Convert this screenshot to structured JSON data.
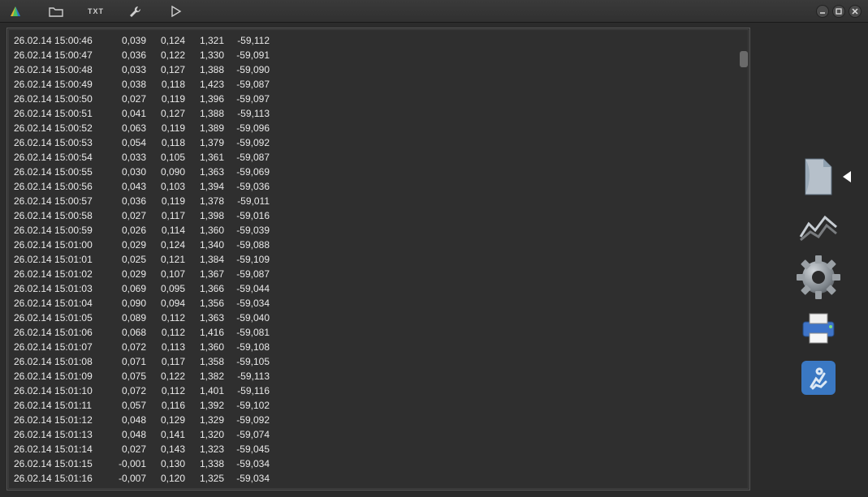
{
  "toolbar": {
    "txt_label": "TXT"
  },
  "icons": {
    "logo": "app-logo",
    "folder": "folder-icon",
    "txt": "txt-icon",
    "wrench": "wrench-icon",
    "play": "play-icon",
    "min": "window-minimize",
    "max": "window-maximize",
    "close": "window-close"
  },
  "palette": {
    "document": "document-tool",
    "chart": "chart-tool",
    "settings": "settings-tool",
    "print": "print-tool",
    "exit": "exit-tool"
  },
  "rows": [
    {
      "ts": "26.02.14 15:00:46",
      "a": "0,039",
      "b": "0,124",
      "c": "1,321",
      "d": "-59,112"
    },
    {
      "ts": "26.02.14 15:00:47",
      "a": "0,036",
      "b": "0,122",
      "c": "1,330",
      "d": "-59,091"
    },
    {
      "ts": "26.02.14 15:00:48",
      "a": "0,033",
      "b": "0,127",
      "c": "1,388",
      "d": "-59,090"
    },
    {
      "ts": "26.02.14 15:00:49",
      "a": "0,038",
      "b": "0,118",
      "c": "1,423",
      "d": "-59,087"
    },
    {
      "ts": "26.02.14 15:00:50",
      "a": "0,027",
      "b": "0,119",
      "c": "1,396",
      "d": "-59,097"
    },
    {
      "ts": "26.02.14 15:00:51",
      "a": "0,041",
      "b": "0,127",
      "c": "1,388",
      "d": "-59,113"
    },
    {
      "ts": "26.02.14 15:00:52",
      "a": "0,063",
      "b": "0,119",
      "c": "1,389",
      "d": "-59,096"
    },
    {
      "ts": "26.02.14 15:00:53",
      "a": "0,054",
      "b": "0,118",
      "c": "1,379",
      "d": "-59,092"
    },
    {
      "ts": "26.02.14 15:00:54",
      "a": "0,033",
      "b": "0,105",
      "c": "1,361",
      "d": "-59,087"
    },
    {
      "ts": "26.02.14 15:00:55",
      "a": "0,030",
      "b": "0,090",
      "c": "1,363",
      "d": "-59,069"
    },
    {
      "ts": "26.02.14 15:00:56",
      "a": "0,043",
      "b": "0,103",
      "c": "1,394",
      "d": "-59,036"
    },
    {
      "ts": "26.02.14 15:00:57",
      "a": "0,036",
      "b": "0,119",
      "c": "1,378",
      "d": "-59,011"
    },
    {
      "ts": "26.02.14 15:00:58",
      "a": "0,027",
      "b": "0,117",
      "c": "1,398",
      "d": "-59,016"
    },
    {
      "ts": "26.02.14 15:00:59",
      "a": "0,026",
      "b": "0,114",
      "c": "1,360",
      "d": "-59,039"
    },
    {
      "ts": "26.02.14 15:01:00",
      "a": "0,029",
      "b": "0,124",
      "c": "1,340",
      "d": "-59,088"
    },
    {
      "ts": "26.02.14 15:01:01",
      "a": "0,025",
      "b": "0,121",
      "c": "1,384",
      "d": "-59,109"
    },
    {
      "ts": "26.02.14 15:01:02",
      "a": "0,029",
      "b": "0,107",
      "c": "1,367",
      "d": "-59,087"
    },
    {
      "ts": "26.02.14 15:01:03",
      "a": "0,069",
      "b": "0,095",
      "c": "1,366",
      "d": "-59,044"
    },
    {
      "ts": "26.02.14 15:01:04",
      "a": "0,090",
      "b": "0,094",
      "c": "1,356",
      "d": "-59,034"
    },
    {
      "ts": "26.02.14 15:01:05",
      "a": "0,089",
      "b": "0,112",
      "c": "1,363",
      "d": "-59,040"
    },
    {
      "ts": "26.02.14 15:01:06",
      "a": "0,068",
      "b": "0,112",
      "c": "1,416",
      "d": "-59,081"
    },
    {
      "ts": "26.02.14 15:01:07",
      "a": "0,072",
      "b": "0,113",
      "c": "1,360",
      "d": "-59,108"
    },
    {
      "ts": "26.02.14 15:01:08",
      "a": "0,071",
      "b": "0,117",
      "c": "1,358",
      "d": "-59,105"
    },
    {
      "ts": "26.02.14 15:01:09",
      "a": "0,075",
      "b": "0,122",
      "c": "1,382",
      "d": "-59,113"
    },
    {
      "ts": "26.02.14 15:01:10",
      "a": "0,072",
      "b": "0,112",
      "c": "1,401",
      "d": "-59,116"
    },
    {
      "ts": "26.02.14 15:01:11",
      "a": "0,057",
      "b": "0,116",
      "c": "1,392",
      "d": "-59,102"
    },
    {
      "ts": "26.02.14 15:01:12",
      "a": "0,048",
      "b": "0,129",
      "c": "1,329",
      "d": "-59,092"
    },
    {
      "ts": "26.02.14 15:01:13",
      "a": "0,048",
      "b": "0,141",
      "c": "1,320",
      "d": "-59,074"
    },
    {
      "ts": "26.02.14 15:01:14",
      "a": "0,027",
      "b": "0,143",
      "c": "1,323",
      "d": "-59,045"
    },
    {
      "ts": "26.02.14 15:01:15",
      "a": "-0,001",
      "b": "0,130",
      "c": "1,338",
      "d": "-59,034"
    },
    {
      "ts": "26.02.14 15:01:16",
      "a": "-0,007",
      "b": "0,120",
      "c": "1,325",
      "d": "-59,034"
    }
  ]
}
